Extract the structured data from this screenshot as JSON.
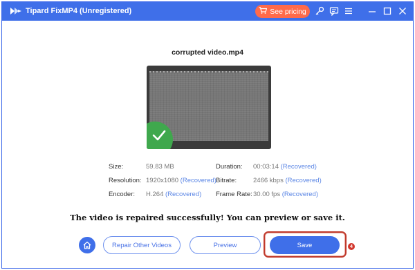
{
  "window": {
    "title": "Tipard FixMP4 (Unregistered)"
  },
  "toolbar": {
    "pricing_label": "See pricing",
    "icons": [
      "cart-icon",
      "key-icon",
      "feedback-icon",
      "menu-icon",
      "minimize-icon",
      "maximize-icon",
      "close-icon"
    ]
  },
  "video": {
    "file_name": "corrupted video.mp4"
  },
  "info": {
    "size": {
      "label": "Size:",
      "value": "59.83 MB",
      "recovered": ""
    },
    "resolution": {
      "label": "Resolution:",
      "value": "1920x1080",
      "recovered": "(Recovered)"
    },
    "encoder": {
      "label": "Encoder:",
      "value": "H.264",
      "recovered": "(Recovered)"
    },
    "duration": {
      "label": "Duration:",
      "value": "00:03:14",
      "recovered": "(Recovered)"
    },
    "bitrate": {
      "label": "Bitrate:",
      "value": "2466 kbps",
      "recovered": "(Recovered)"
    },
    "frame_rate": {
      "label": "Frame Rate:",
      "value": "30.00 fps",
      "recovered": "(Recovered)"
    }
  },
  "message": "The video is repaired successfully! You can preview or save it.",
  "buttons": {
    "repair_other": "Repair Other Videos",
    "preview": "Preview",
    "save": "Save"
  },
  "annotation": {
    "step": "4"
  },
  "colors": {
    "brand": "#3f6fe9",
    "pricing": "#ff6a4a",
    "success": "#3fa84d",
    "recovered_text": "#5b86e5",
    "highlight": "#c0392b"
  }
}
